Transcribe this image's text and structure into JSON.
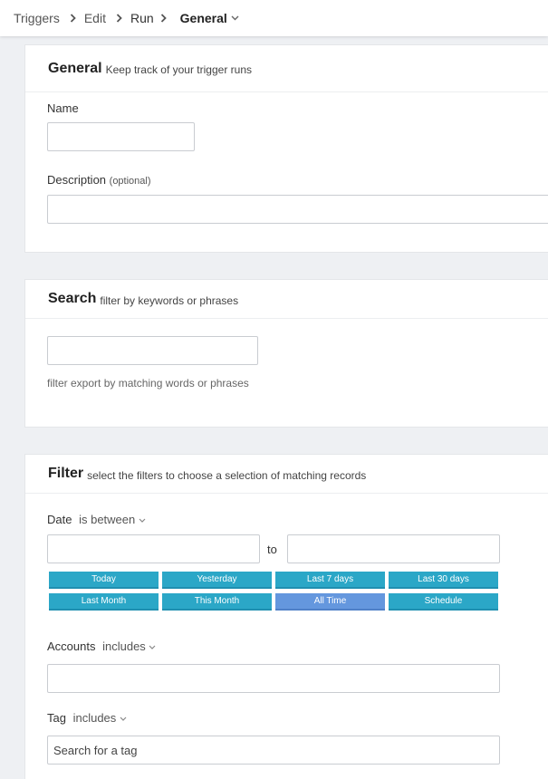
{
  "breadcrumb": {
    "items": [
      "Triggers",
      "Edit",
      "Run",
      "General"
    ]
  },
  "general": {
    "title": "General",
    "subtitle": "Keep track of your trigger runs",
    "name_label": "Name",
    "name_value": "",
    "description_label": "Description",
    "description_optional": "(optional)",
    "description_value": ""
  },
  "search": {
    "title": "Search",
    "subtitle": "filter by keywords or phrases",
    "value": "",
    "help": "filter export by matching words or phrases"
  },
  "filter": {
    "title": "Filter",
    "subtitle": "select the filters to choose a selection of matching records",
    "date_label": "Date",
    "date_operator": "is between",
    "date_from": "",
    "to_label": "to",
    "date_to": "",
    "quick_ranges": [
      "Today",
      "Yesterday",
      "Last 7 days",
      "Last 30 days",
      "Last Month",
      "This Month",
      "All Time",
      "Schedule"
    ],
    "active_range": "All Time",
    "accounts_label": "Accounts",
    "accounts_operator": "includes",
    "accounts_value": "",
    "tag_label": "Tag",
    "tag_operator": "includes",
    "tag_placeholder": "Search for a tag"
  },
  "colors": {
    "button": "#2ba7c7",
    "button_active": "#6497de"
  }
}
